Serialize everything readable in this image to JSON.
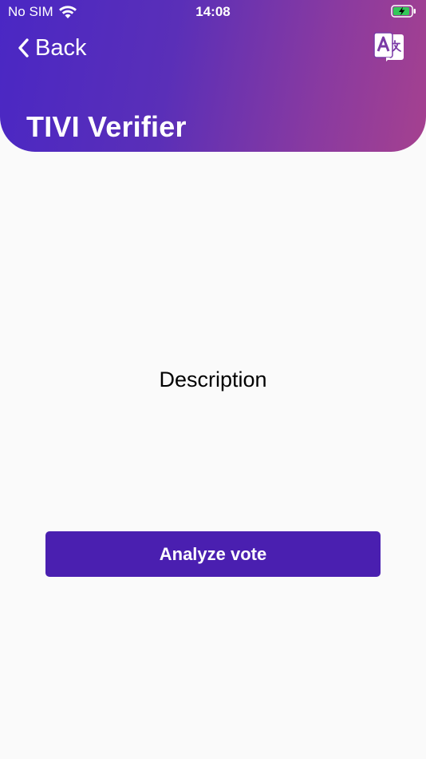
{
  "status_bar": {
    "carrier": "No SIM",
    "time": "14:08",
    "wifi_icon": "wifi-icon",
    "battery_icon": "battery-charging-icon"
  },
  "nav": {
    "back_label": "Back",
    "back_icon": "chevron-left-icon",
    "translate_icon": "translate-icon"
  },
  "header": {
    "title": "TIVI Verifier",
    "gradient_start": "#4a27c4",
    "gradient_end": "#a5418f"
  },
  "main": {
    "description": "Description",
    "analyze_button_label": "Analyze vote",
    "button_color": "#4a1fb0"
  }
}
